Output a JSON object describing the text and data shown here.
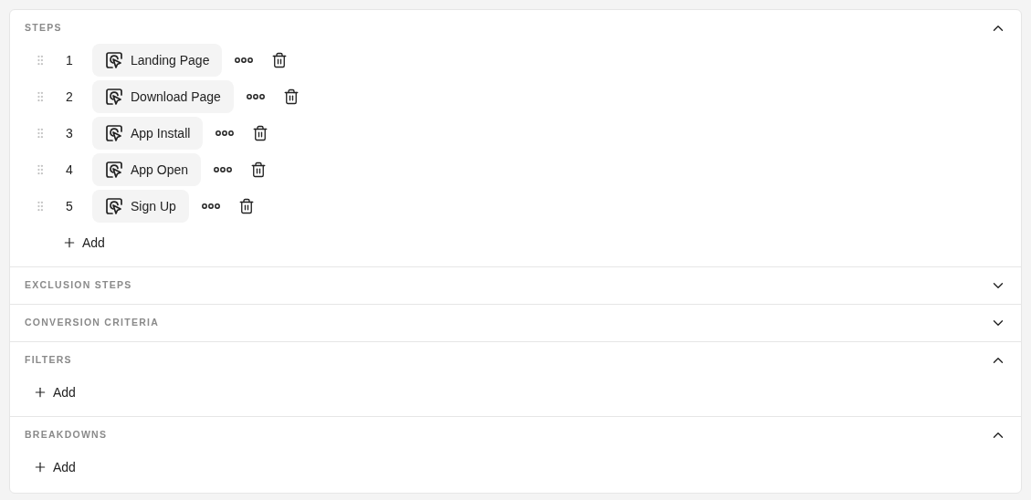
{
  "sections": [
    {
      "title": "STEPS",
      "expanded": true,
      "steps": [
        {
          "number": "1",
          "label": "Landing Page"
        },
        {
          "number": "2",
          "label": "Download Page"
        },
        {
          "number": "3",
          "label": "App Install"
        },
        {
          "number": "4",
          "label": "App Open"
        },
        {
          "number": "5",
          "label": "Sign Up"
        }
      ],
      "add_label": "Add"
    },
    {
      "title": "EXCLUSION STEPS",
      "expanded": false
    },
    {
      "title": "CONVERSION CRITERIA",
      "expanded": false
    },
    {
      "title": "FILTERS",
      "expanded": true,
      "add_label": "Add"
    },
    {
      "title": "BREAKDOWNS",
      "expanded": true,
      "add_label": "Add"
    }
  ]
}
